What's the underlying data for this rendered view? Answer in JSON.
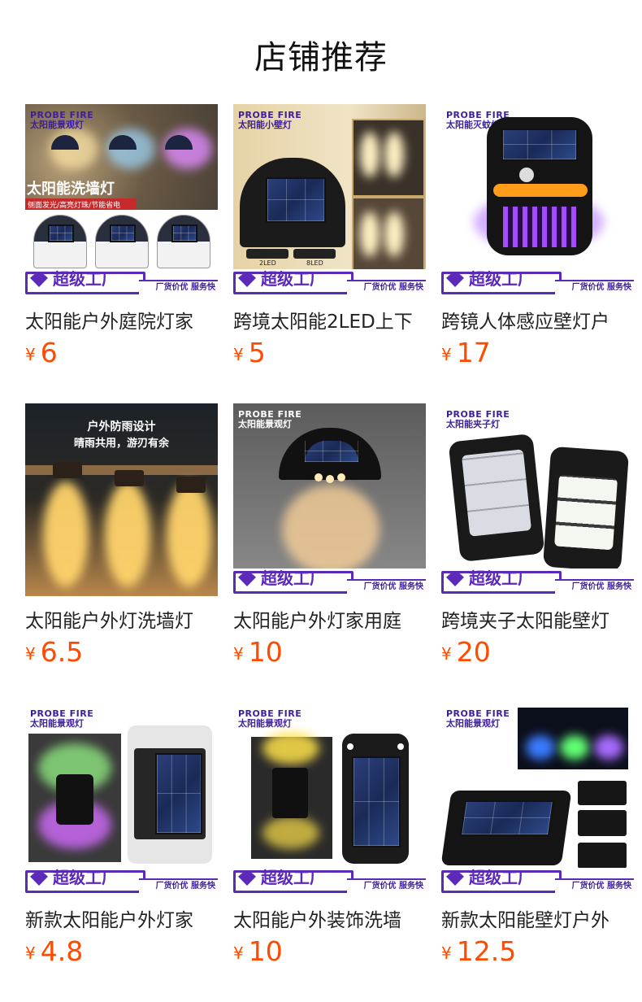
{
  "page": {
    "title": "店铺推荐"
  },
  "currency": "¥",
  "badge": {
    "main": "超级工厂",
    "sub": "厂货价优 服务快"
  },
  "brand_logo": "PROBE FIRE",
  "products": [
    {
      "name": "太阳能户外庭院灯家",
      "price": "6",
      "brand_sub": "太阳能景观灯",
      "overlay_title": "太阳能洗墙灯",
      "overlay_sub": "侧面发光/高亮灯珠/节能省电"
    },
    {
      "name": "跨境太阳能2LED上下",
      "price": "5",
      "brand_sub": "太阳能小壁灯",
      "tag_a": "2LED",
      "tag_b": "8LED"
    },
    {
      "name": "跨镜人体感应壁灯户",
      "price": "17",
      "brand_sub": "太阳能灭蚊灯"
    },
    {
      "name": "太阳能户外灯洗墙灯",
      "price": "6.5",
      "overlay_title": "户外防雨设计",
      "overlay_sub": "晴雨共用，游刃有余"
    },
    {
      "name": "太阳能户外灯家用庭",
      "price": "10",
      "brand_sub": "太阳能景观灯"
    },
    {
      "name": "跨境夹子太阳能壁灯",
      "price": "20",
      "brand_sub": "太阳能夹子灯"
    },
    {
      "name": "新款太阳能户外灯家",
      "price": "4.8",
      "brand_sub": "太阳能景观灯"
    },
    {
      "name": "太阳能户外装饰洗墙",
      "price": "10",
      "brand_sub": "太阳能景观灯"
    },
    {
      "name": "新款太阳能壁灯户外",
      "price": "12.5",
      "brand_sub": "太阳能景观灯"
    }
  ]
}
